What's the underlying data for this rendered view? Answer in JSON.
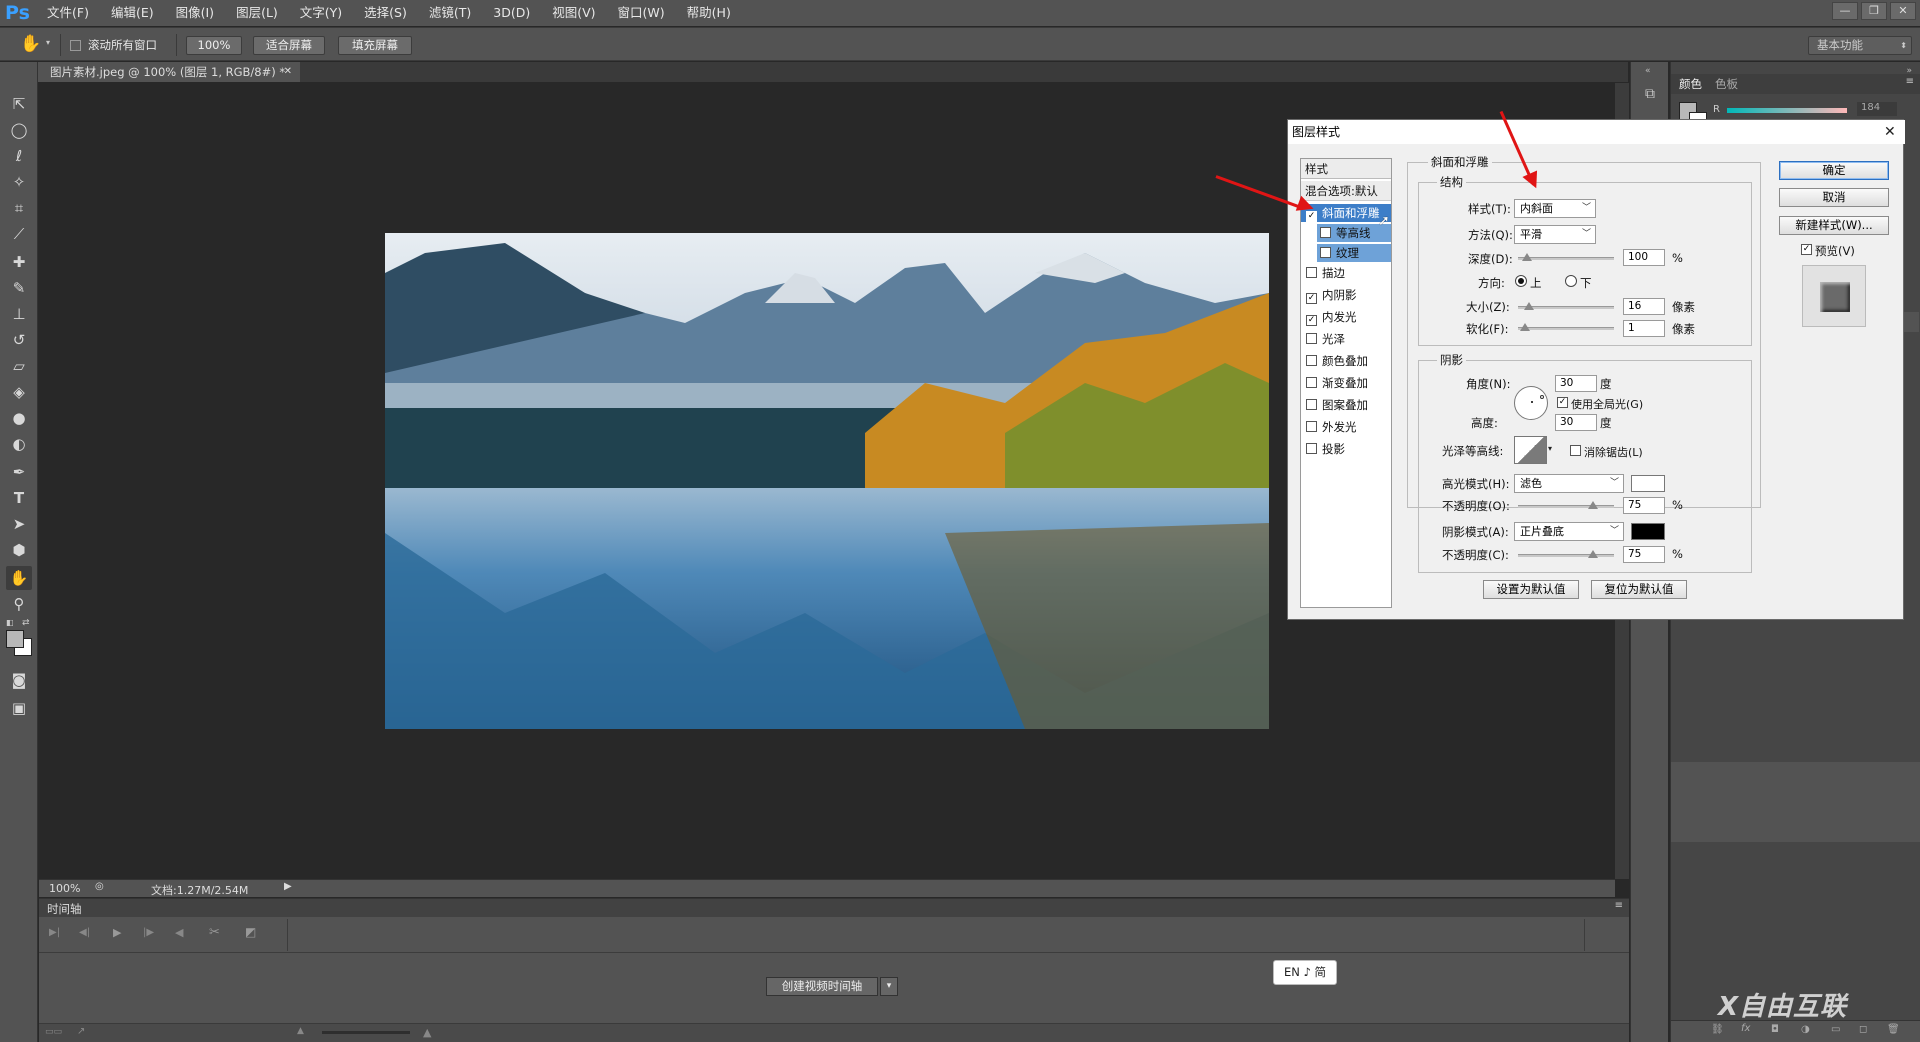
{
  "app": {
    "logo": "Ps",
    "menu": [
      "文件(F)",
      "编辑(E)",
      "图像(I)",
      "图层(L)",
      "文字(Y)",
      "选择(S)",
      "滤镜(T)",
      "3D(D)",
      "视图(V)",
      "窗口(W)",
      "帮助(H)"
    ],
    "window_buttons": [
      "—",
      "❐",
      "✕"
    ]
  },
  "options": {
    "scroll_all_windows": "滚动所有窗口",
    "zoom_btn": "100%",
    "fit_screen": "适合屏幕",
    "fill_screen": "填充屏幕",
    "workspace": "基本功能"
  },
  "document": {
    "tab_title": "图片素材.jpeg @ 100% (图层 1, RGB/8#) *",
    "zoom": "100%",
    "doc_info": "文档:1.27M/2.54M"
  },
  "timeline": {
    "title": "时间轴",
    "create_button": "创建视频时间轴"
  },
  "ime": {
    "label": "EN ♪ 简"
  },
  "right_panel": {
    "tab_color": "颜色",
    "tab_swatches": "色板",
    "r_label": "R",
    "r_value": "184"
  },
  "watermark": {
    "text": "X自由互联"
  },
  "dialog": {
    "title": "图层样式",
    "close": "✕",
    "styles_header": "样式",
    "blend_default": "混合选项:默认",
    "style_list": [
      {
        "label": "斜面和浮雕",
        "checked": true,
        "selected": true
      },
      {
        "label": "等高线",
        "checked": false,
        "indent": true
      },
      {
        "label": "纹理",
        "checked": false,
        "indent": true
      },
      {
        "label": "描边",
        "checked": false
      },
      {
        "label": "内阴影",
        "checked": true
      },
      {
        "label": "内发光",
        "checked": true
      },
      {
        "label": "光泽",
        "checked": false
      },
      {
        "label": "颜色叠加",
        "checked": false
      },
      {
        "label": "渐变叠加",
        "checked": false
      },
      {
        "label": "图案叠加",
        "checked": false
      },
      {
        "label": "外发光",
        "checked": false
      },
      {
        "label": "投影",
        "checked": false
      }
    ],
    "bevel": {
      "title": "斜面和浮雕",
      "structure": "结构",
      "style_label": "样式(T):",
      "style_value": "内斜面",
      "technique_label": "方法(Q):",
      "technique_value": "平滑",
      "depth_label": "深度(D):",
      "depth_value": "100",
      "percent": "%",
      "direction_label": "方向:",
      "dir_up": "上",
      "dir_down": "下",
      "size_label": "大小(Z):",
      "size_value": "16",
      "px": "像素",
      "soften_label": "软化(F):",
      "soften_value": "1"
    },
    "shading": {
      "title": "阴影",
      "angle_label": "角度(N):",
      "angle_value": "30",
      "degree": "度",
      "global_light": "使用全局光(G)",
      "altitude_label": "高度:",
      "altitude_value": "30",
      "gloss_label": "光泽等高线:",
      "antialias": "消除锯齿(L)",
      "highlight_label": "高光模式(H):",
      "highlight_value": "滤色",
      "h_opacity_label": "不透明度(O):",
      "h_opacity_value": "75",
      "shadow_label": "阴影模式(A):",
      "shadow_value": "正片叠底",
      "s_opacity_label": "不透明度(C):",
      "s_opacity_value": "75"
    },
    "make_default": "设置为默认值",
    "reset_default": "复位为默认值",
    "ok": "确定",
    "cancel": "取消",
    "new_style": "新建样式(W)...",
    "preview": "预览(V)"
  }
}
